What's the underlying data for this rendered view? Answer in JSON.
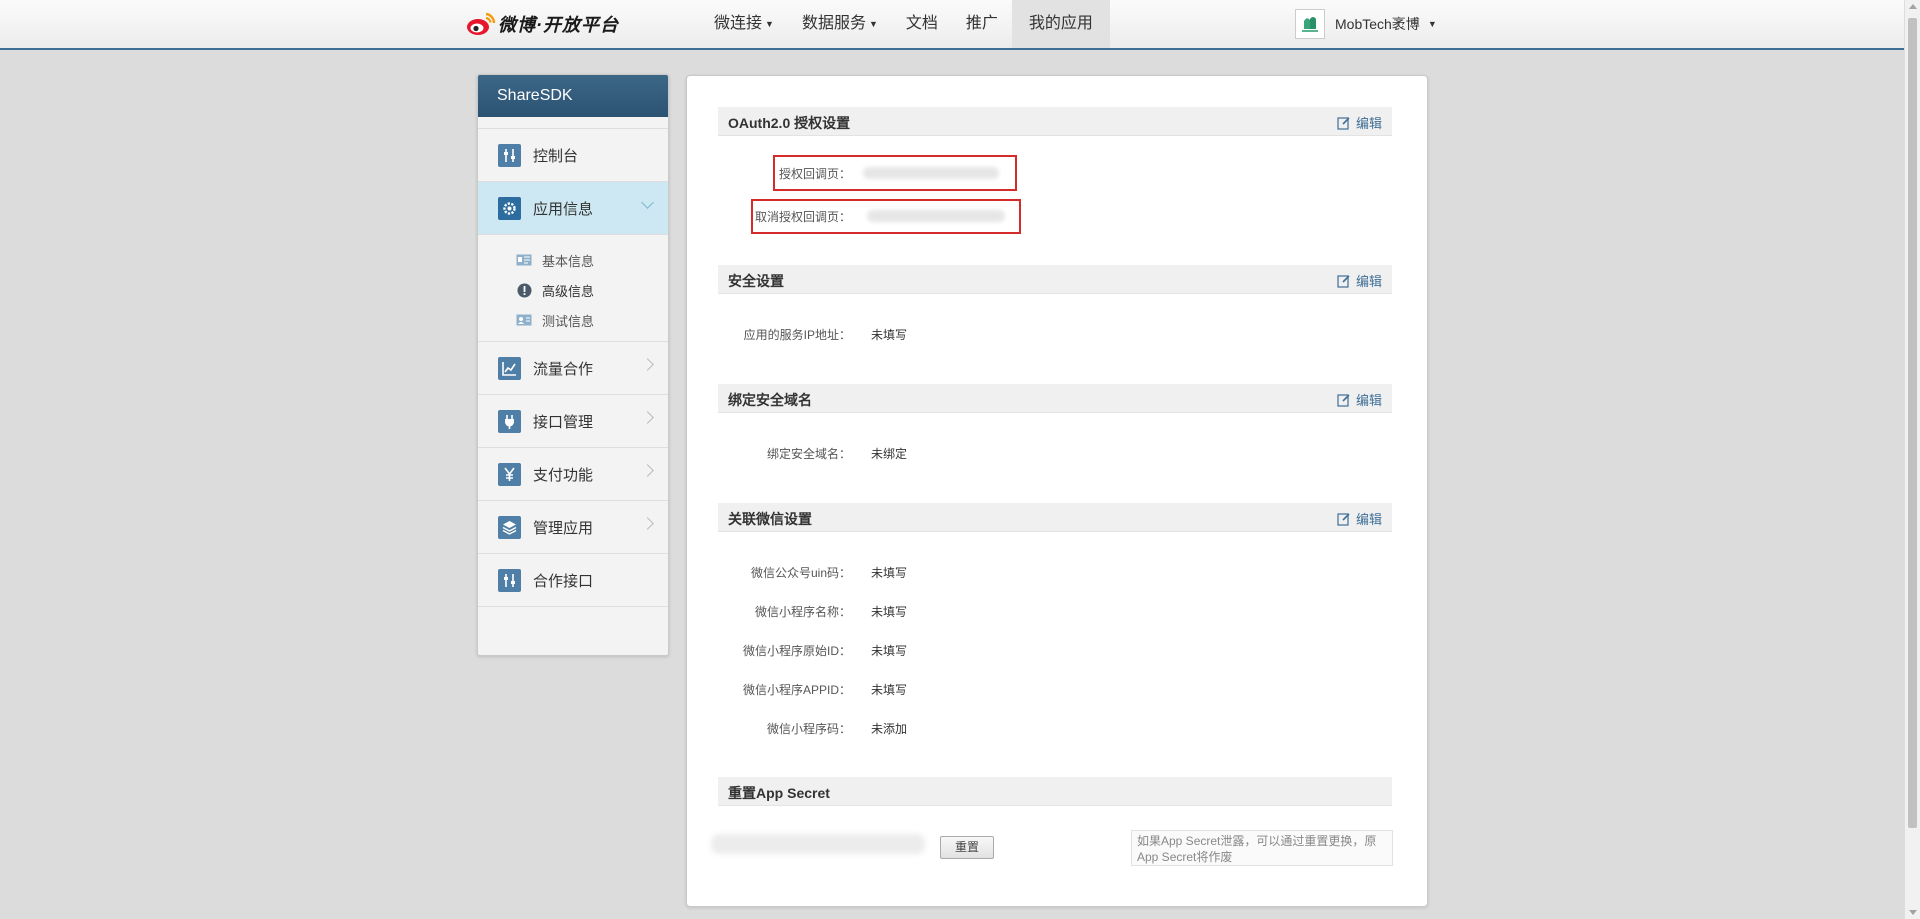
{
  "header": {
    "logo_text": "微博·开放平台",
    "nav": [
      {
        "label": "微连接",
        "caret": true
      },
      {
        "label": "数据服务",
        "caret": true
      },
      {
        "label": "文档",
        "caret": false
      },
      {
        "label": "推广",
        "caret": false
      },
      {
        "label": "我的应用",
        "caret": false,
        "active": true
      }
    ],
    "user_name": "MobTech袤博"
  },
  "sidebar": {
    "title": "ShareSDK",
    "items": [
      {
        "label": "控制台",
        "icon": "sliders-icon"
      },
      {
        "label": "应用信息",
        "icon": "gear-icon",
        "active": true,
        "expanded": true
      },
      {
        "label": "流量合作",
        "icon": "chart-icon"
      },
      {
        "label": "接口管理",
        "icon": "plug-icon"
      },
      {
        "label": "支付功能",
        "icon": "yen-icon"
      },
      {
        "label": "管理应用",
        "icon": "layers-icon"
      },
      {
        "label": "合作接口",
        "icon": "sliders-icon"
      }
    ],
    "sub_items": [
      {
        "label": "基本信息",
        "icon": "id-card-icon"
      },
      {
        "label": "高级信息",
        "icon": "info-circle-icon",
        "active": true
      },
      {
        "label": "测试信息",
        "icon": "id-card-icon"
      }
    ]
  },
  "main": {
    "edit_label": "编辑",
    "oauth": {
      "title": "OAuth2.0 授权设置",
      "callback_label": "授权回调页：",
      "cancel_callback_label": "取消授权回调页："
    },
    "security": {
      "title": "安全设置",
      "server_ip_label": "应用的服务IP地址：",
      "server_ip_value": "未填写"
    },
    "domain": {
      "title": "绑定安全域名",
      "domain_label": "绑定安全域名：",
      "domain_value": "未绑定"
    },
    "wechat": {
      "title": "关联微信设置",
      "rows": [
        {
          "label": "微信公众号uin码：",
          "value": "未填写"
        },
        {
          "label": "微信小程序名称：",
          "value": "未填写"
        },
        {
          "label": "微信小程序原始ID：",
          "value": "未填写"
        },
        {
          "label": "微信小程序APPID：",
          "value": "未填写"
        },
        {
          "label": "微信小程序码：",
          "value": "未添加"
        }
      ]
    },
    "reset": {
      "title": "重置App Secret",
      "button_label": "重置",
      "hint": "如果App Secret泄露，可以通过重置更换，原App Secret将作废"
    }
  },
  "colors": {
    "nav_border": "#3f6f97",
    "sidebar_header": "#2b5273",
    "active_bg": "#cde8f2",
    "highlight_box": "#d62b2b",
    "link": "#3f6f97"
  }
}
